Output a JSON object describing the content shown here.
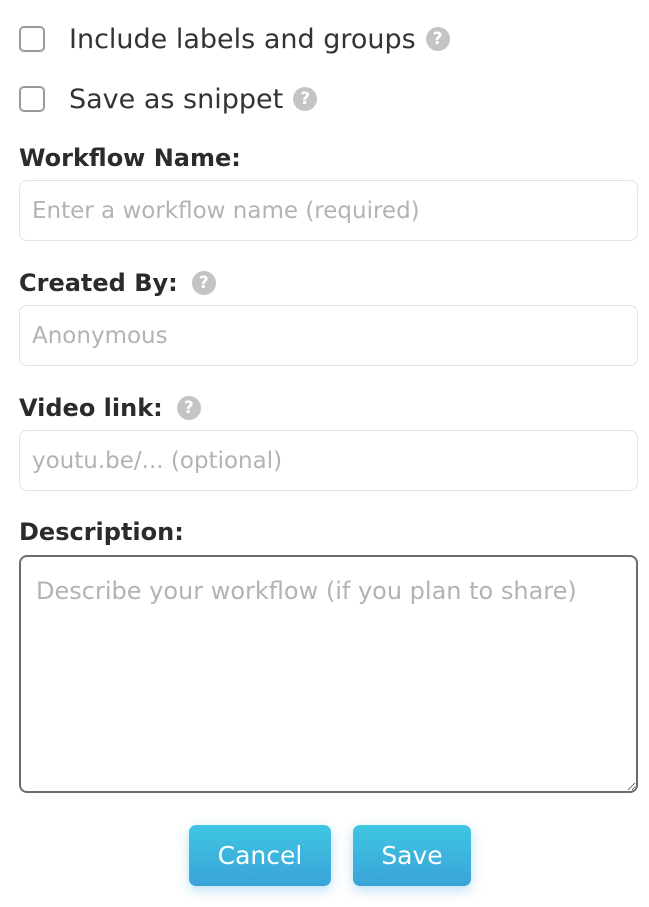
{
  "options": {
    "include_labels": {
      "label": "Include labels and groups",
      "checked": false,
      "help_icon": "question-circle-icon"
    },
    "save_snippet": {
      "label": "Save as snippet",
      "checked": false,
      "help_icon": "question-circle-icon"
    }
  },
  "fields": {
    "workflow_name": {
      "label": "Workflow Name:",
      "placeholder": "Enter a workflow name (required)",
      "value": ""
    },
    "created_by": {
      "label": "Created By:",
      "placeholder": "Anonymous",
      "value": "",
      "help_icon": "question-circle-icon"
    },
    "video_link": {
      "label": "Video link:",
      "placeholder": "youtu.be/... (optional)",
      "value": "",
      "help_icon": "question-circle-icon"
    },
    "description": {
      "label": "Description:",
      "placeholder": "Describe your workflow (if you plan to share)",
      "value": ""
    }
  },
  "buttons": {
    "cancel_label": "Cancel",
    "save_label": "Save"
  },
  "colors": {
    "button_gradient_top": "#3fc6e2",
    "button_gradient_bottom": "#3aa3d9",
    "help_icon": "#c4c4c4",
    "placeholder": "#b3b3b3"
  }
}
